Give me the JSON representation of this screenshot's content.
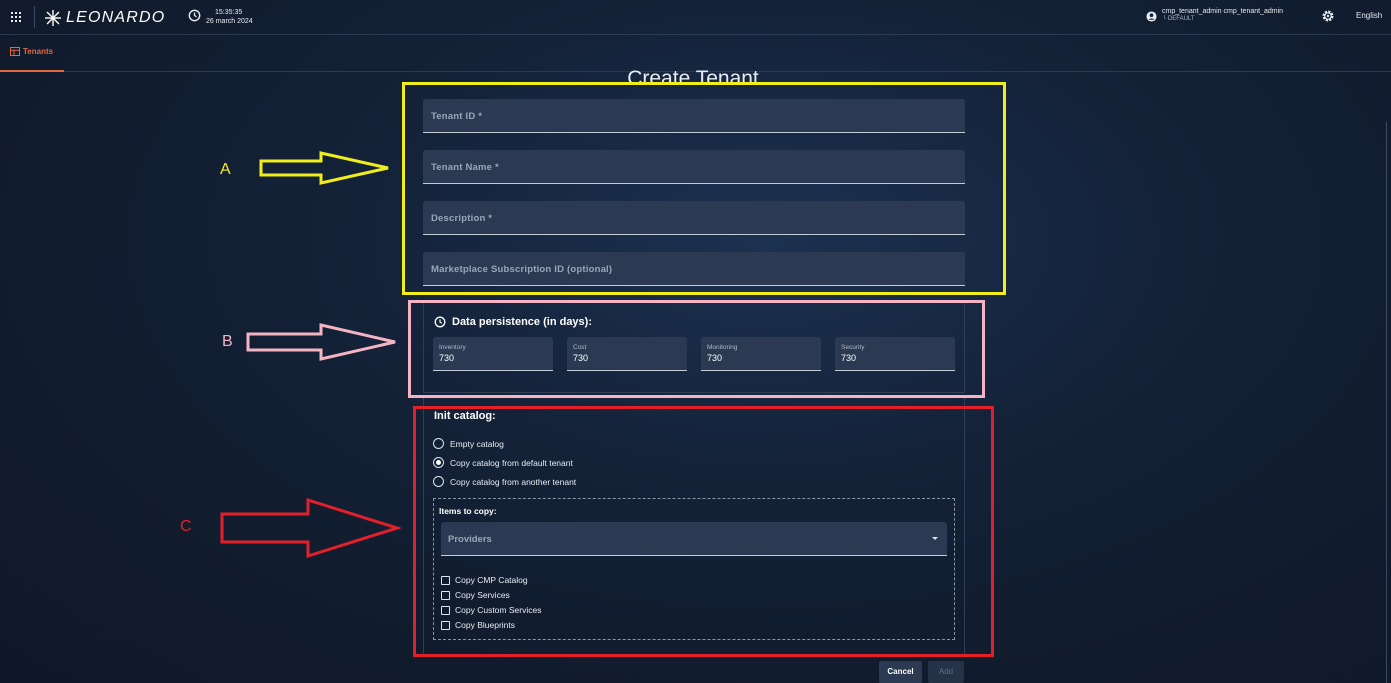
{
  "header": {
    "brand": "LEONARDO",
    "time": "15:35:35",
    "date": "26 march 2024",
    "user_name": "cmp_tenant_admin cmp_tenant_admin",
    "user_tenant": "└ DEFAULT",
    "language": "English"
  },
  "tabs": [
    {
      "label": "Tenants",
      "active": true,
      "icon": "table-icon"
    }
  ],
  "form": {
    "title": "Create Tenant",
    "fields": [
      {
        "label": "Tenant ID *",
        "value": ""
      },
      {
        "label": "Tenant Name *",
        "value": ""
      },
      {
        "label": "Description *",
        "value": ""
      },
      {
        "label": "Marketplace Subscription ID (optional)",
        "value": ""
      }
    ],
    "data_persistence": {
      "title": "Data persistence (in days):",
      "icon": "history-icon",
      "fields": [
        {
          "label": "Inventory",
          "value": "730"
        },
        {
          "label": "Cost",
          "value": "730"
        },
        {
          "label": "Monitoring",
          "value": "730"
        },
        {
          "label": "Security",
          "value": "730"
        }
      ]
    },
    "init_catalog": {
      "title": "Init catalog:",
      "options": [
        {
          "label": "Empty catalog",
          "selected": false
        },
        {
          "label": "Copy catalog from default tenant",
          "selected": true
        },
        {
          "label": "Copy catalog from another tenant",
          "selected": false
        }
      ],
      "items_to_copy": {
        "title": "Items to copy:",
        "select_value": "Providers",
        "checkboxes": [
          {
            "label": "Copy CMP Catalog",
            "checked": false
          },
          {
            "label": "Copy Services",
            "checked": false
          },
          {
            "label": "Copy Custom Services",
            "checked": false
          },
          {
            "label": "Copy Blueprints",
            "checked": false
          }
        ]
      }
    },
    "buttons": {
      "cancel": "Cancel",
      "add": "Add"
    }
  },
  "annotations": [
    {
      "letter": "A",
      "color": "#f2ee1b"
    },
    {
      "letter": "B",
      "color": "#f4b4c4"
    },
    {
      "letter": "C",
      "color": "#e3202a"
    }
  ],
  "colors": {
    "accent": "#e8663c",
    "field_bg": "#2b3a52"
  }
}
